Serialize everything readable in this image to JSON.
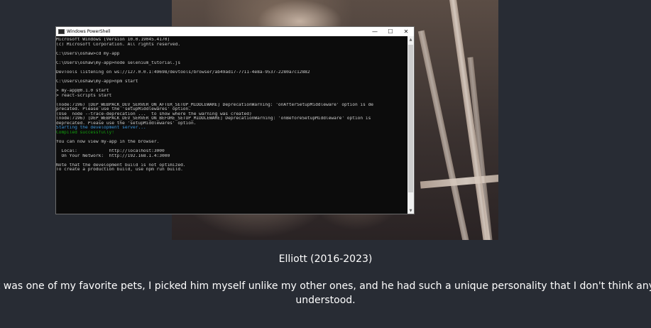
{
  "terminal": {
    "window_title": "Windows PowerShell",
    "controls": {
      "minimize": "—",
      "maximize": "☐",
      "close": "✕"
    },
    "lines": [
      {
        "text": "Microsoft Windows [Version 10.0.19045.4170]",
        "color": "default"
      },
      {
        "text": "(c) Microsoft Corporation. All rights reserved.",
        "color": "default"
      },
      {
        "text": "",
        "color": "default"
      },
      {
        "text": "C:\\Users\\oshaw>cd my-app",
        "color": "default"
      },
      {
        "text": "",
        "color": "default"
      },
      {
        "text": "C:\\Users\\oshaw\\my-app>node selenium_tutorial.js",
        "color": "default"
      },
      {
        "text": "",
        "color": "default"
      },
      {
        "text": "DevTools listening on ws://127.0.0.1:49698/devtools/browser/ab49ad17-7711-4e8a-9537-2280a7c12882",
        "color": "default"
      },
      {
        "text": "",
        "color": "default"
      },
      {
        "text": "C:\\Users\\oshaw\\my-app>npm start",
        "color": "default"
      },
      {
        "text": "",
        "color": "default"
      },
      {
        "text": "> my-app@0.1.0 start",
        "color": "default"
      },
      {
        "text": "> react-scripts start",
        "color": "default"
      },
      {
        "text": "",
        "color": "default"
      },
      {
        "text": "(node:7196) [DEP_WEBPACK_DEV_SERVER_ON_AFTER_SETUP_MIDDLEWARE] DeprecationWarning: 'onAfterSetupMiddleware' option is de",
        "color": "default"
      },
      {
        "text": "precated. Please use the 'setupMiddlewares' option.",
        "color": "default"
      },
      {
        "text": "(Use `node --trace-deprecation ...` to show where the warning was created)",
        "color": "default"
      },
      {
        "text": "(node:7196) [DEP_WEBPACK_DEV_SERVER_ON_BEFORE_SETUP_MIDDLEWARE] DeprecationWarning: 'onBeforeSetupMiddleware' option is",
        "color": "default"
      },
      {
        "text": "deprecated. Please use the 'setupMiddlewares' option.",
        "color": "default"
      },
      {
        "text": "Starting the development server...",
        "color": "cyan"
      },
      {
        "text": "Compiled successfully!",
        "color": "green"
      },
      {
        "text": "",
        "color": "default"
      },
      {
        "text": "You can now view my-app in the browser.",
        "color": "default"
      },
      {
        "text": "",
        "color": "default"
      },
      {
        "text": "  Local:            http://localhost:3000",
        "color": "default"
      },
      {
        "text": "  On Your Network:  http://192.168.1.4:3000",
        "color": "default"
      },
      {
        "text": "",
        "color": "default"
      },
      {
        "text": "Note that the development build is not optimized.",
        "color": "default"
      },
      {
        "text": "To create a production build, use npm run build.",
        "color": "default"
      }
    ]
  },
  "caption": {
    "title": "Elliott (2016-2023)",
    "body": "Elliott was one of my favorite pets, I picked him myself unlike my other ones, and he had such a unique personality that I don't think anybody understood."
  },
  "colors": {
    "page_background": "#282c34",
    "terminal_background": "#0c0c0c",
    "terminal_text": "#cccccc",
    "terminal_cyan": "#3a96dd",
    "terminal_green": "#13a10e"
  }
}
